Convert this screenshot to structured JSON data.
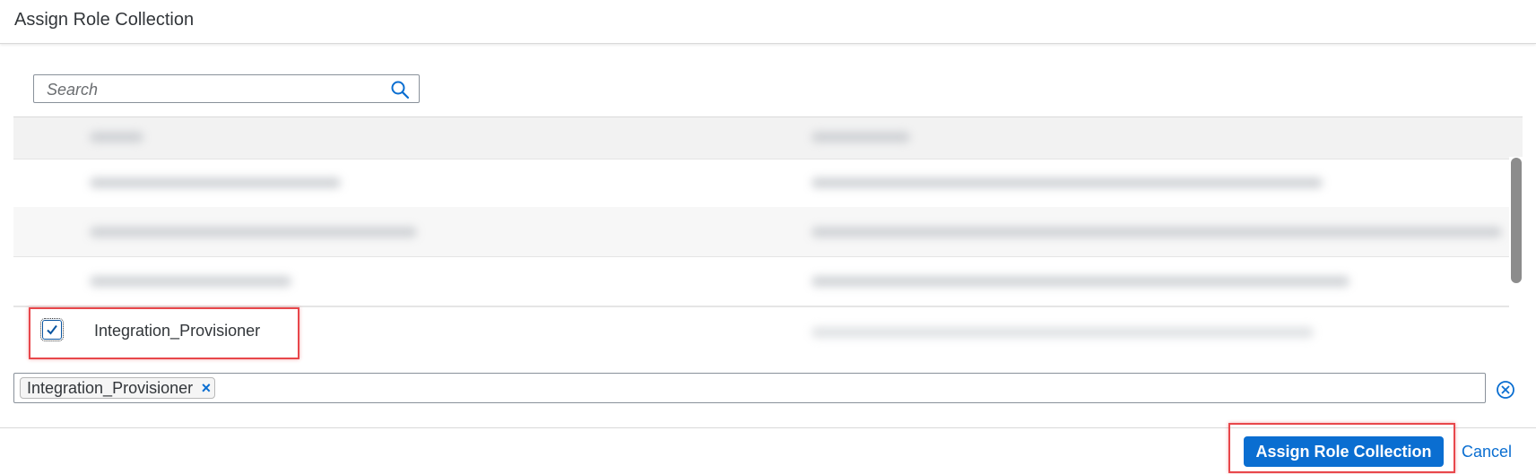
{
  "dialog": {
    "title": "Assign Role Collection"
  },
  "search": {
    "placeholder": "Search",
    "icon": "search-icon"
  },
  "table": {
    "selected_row": {
      "name": "Integration_Provisioner",
      "checked": true
    }
  },
  "token_input": {
    "tokens": [
      {
        "label": "Integration_Provisioner",
        "remove_icon": "close-icon"
      }
    ],
    "clear_icon": "clear-circle-icon"
  },
  "footer": {
    "assign_label": "Assign Role Collection",
    "cancel_label": "Cancel"
  },
  "colors": {
    "accent": "#0a6ed1",
    "highlight": "#e8474b"
  }
}
